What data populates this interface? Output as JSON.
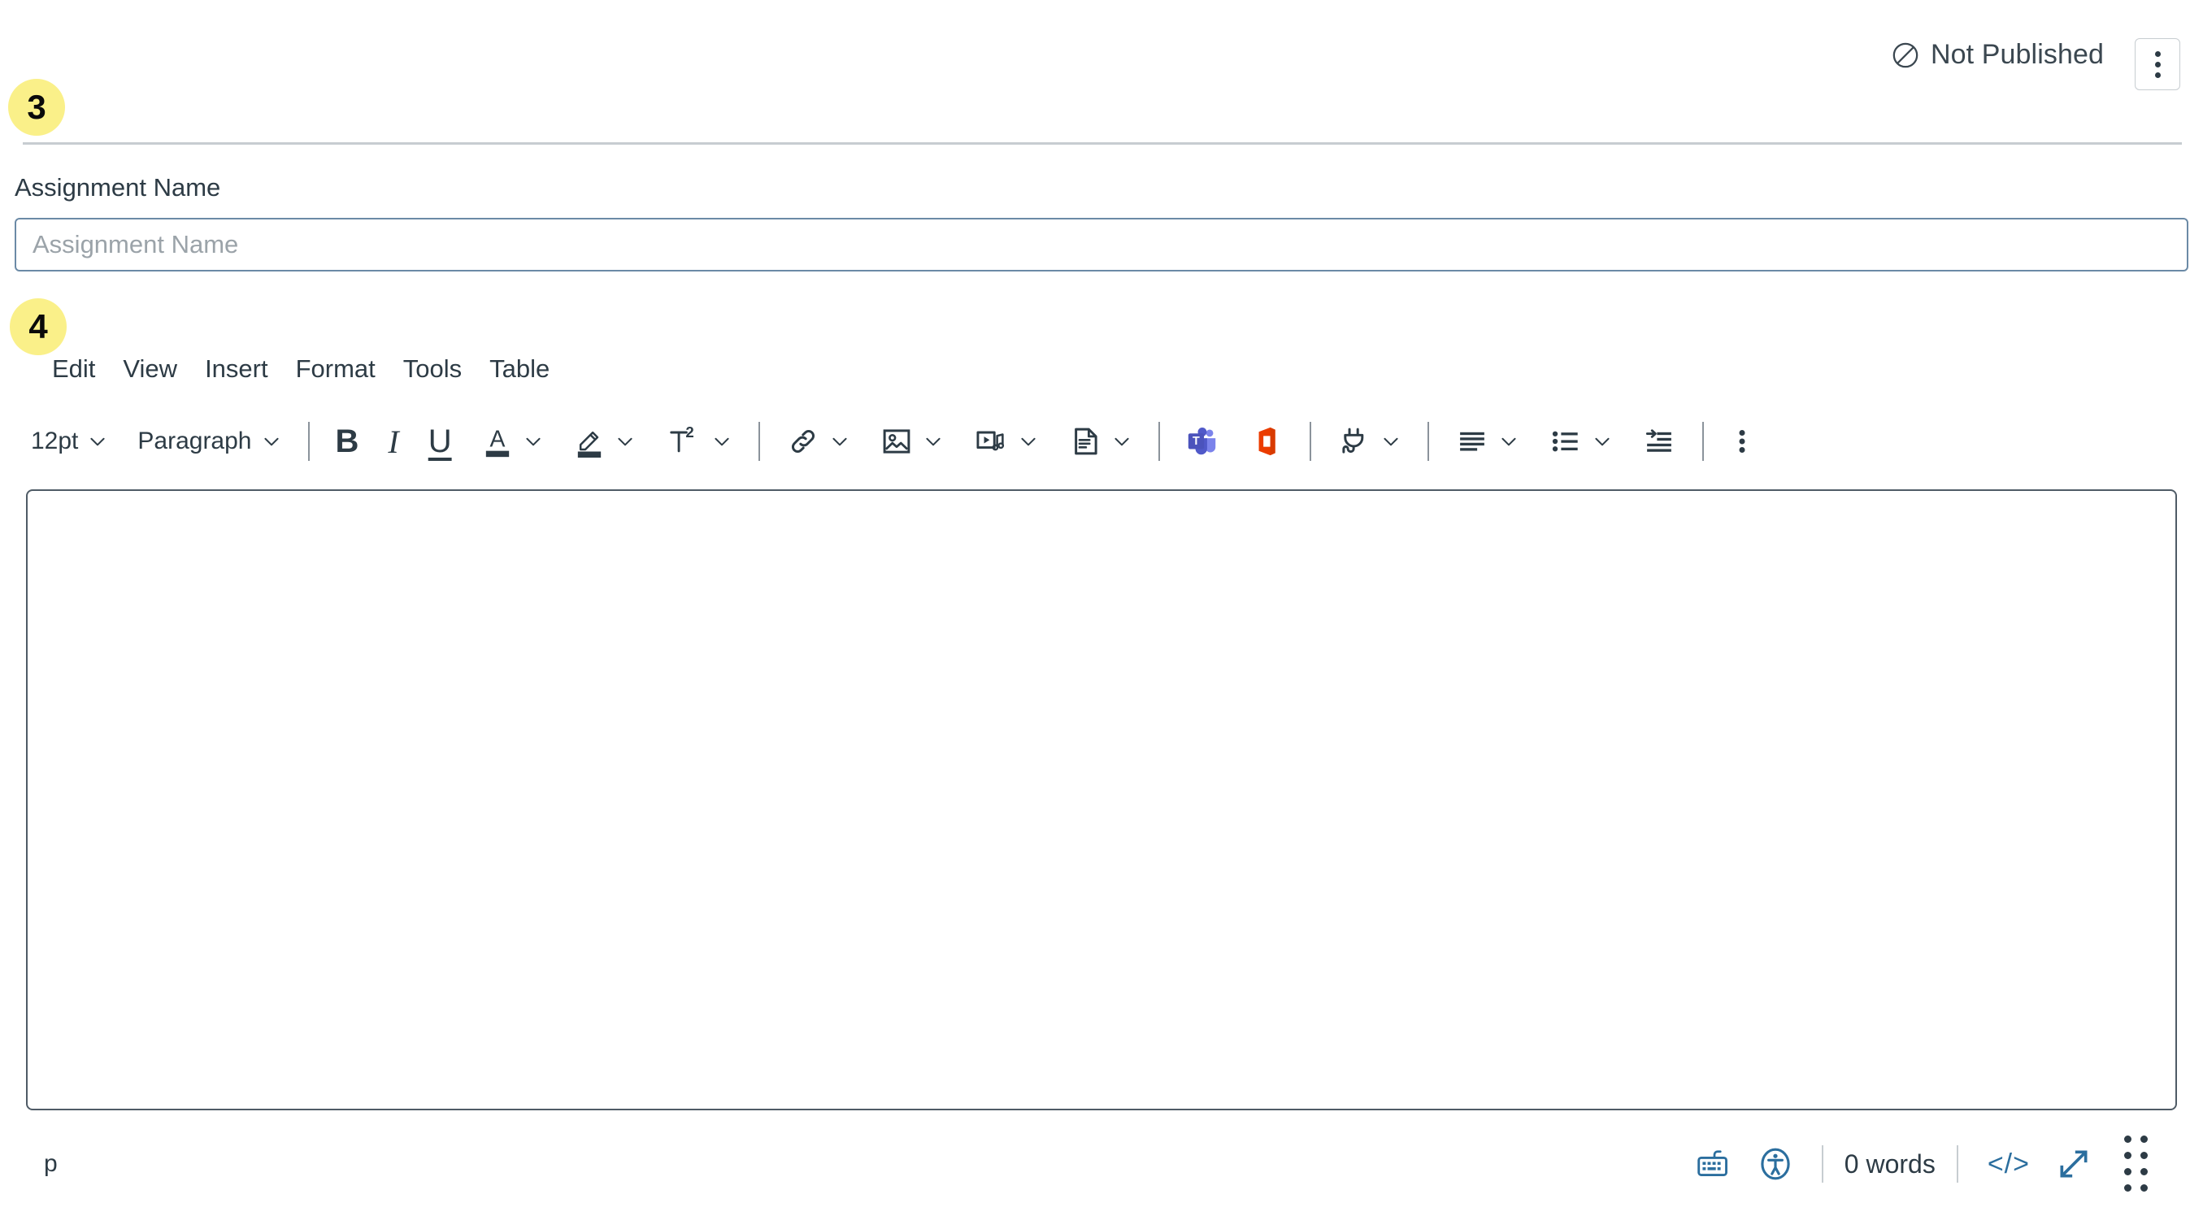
{
  "header": {
    "status_label": "Not Published",
    "status_icon": "circle-slash-icon",
    "more_options_icon": "kebab-menu-icon"
  },
  "annotations": [
    {
      "number": "3",
      "color": "#FAF089"
    },
    {
      "number": "4",
      "color": "#FAF089"
    }
  ],
  "assignment_name": {
    "label": "Assignment Name",
    "placeholder": "Assignment Name",
    "value": ""
  },
  "rce": {
    "menubar": [
      {
        "label": "Edit"
      },
      {
        "label": "View"
      },
      {
        "label": "Insert"
      },
      {
        "label": "Format"
      },
      {
        "label": "Tools"
      },
      {
        "label": "Table"
      }
    ],
    "toolbar": {
      "font_size": "12pt",
      "block_format": "Paragraph",
      "buttons": [
        {
          "name": "bold",
          "glyph": "B"
        },
        {
          "name": "italic",
          "glyph": "I"
        },
        {
          "name": "underline",
          "glyph": "U"
        },
        {
          "name": "text-color",
          "glyph": "A"
        },
        {
          "name": "highlight-color",
          "glyph": "highlighter-icon"
        },
        {
          "name": "superscript",
          "glyph": "T"
        },
        {
          "name": "superscript-exponent",
          "glyph": "2"
        },
        {
          "name": "link",
          "glyph": "link-icon"
        },
        {
          "name": "image",
          "glyph": "image-icon"
        },
        {
          "name": "media",
          "glyph": "media-icon"
        },
        {
          "name": "document",
          "glyph": "document-icon"
        },
        {
          "name": "microsoft-teams",
          "glyph": "teams-icon"
        },
        {
          "name": "office-365",
          "glyph": "office-icon"
        },
        {
          "name": "apps",
          "glyph": "plug-icon"
        },
        {
          "name": "align",
          "glyph": "align-left-icon"
        },
        {
          "name": "bullet-list",
          "glyph": "bullet-list-icon"
        },
        {
          "name": "indent",
          "glyph": "indent-icon"
        },
        {
          "name": "more",
          "glyph": "kebab-menu-icon"
        }
      ]
    },
    "body_content": "",
    "statusbar": {
      "element_path": "p",
      "word_count": "0 words",
      "html_editor_glyph": "</>",
      "keyboard_icon": "keyboard-icon",
      "a11y_icon": "accessibility-icon",
      "fullscreen_icon": "fullscreen-arrows-icon",
      "resize_icon": "resize-handle-icon"
    }
  },
  "colors": {
    "accent_blue": "#2B6E9E",
    "text": "#2D3B45",
    "border": "#C7CDD1",
    "badge_yellow": "#FAF089",
    "teams_purple": "#5059C9",
    "office_orange": "#EB3C00"
  }
}
